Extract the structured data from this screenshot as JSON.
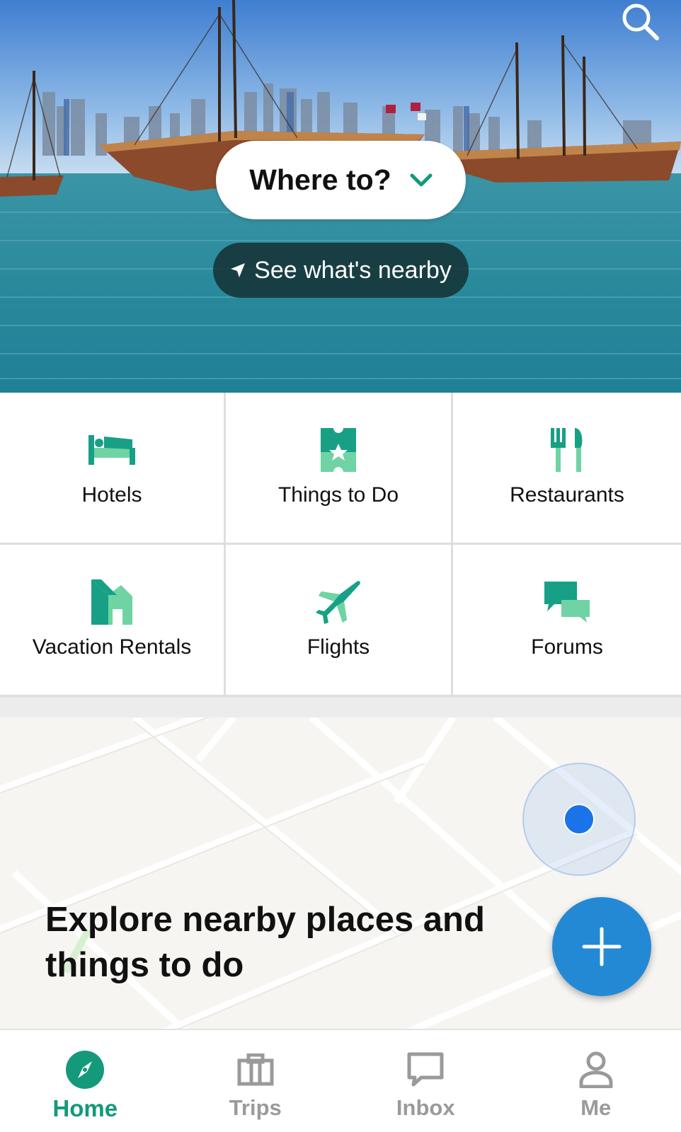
{
  "hero": {
    "where_to_label": "Where to?",
    "nearby_label": "See what's nearby"
  },
  "icons": {
    "search": "search-icon",
    "chevron": "chevron-down-icon",
    "location_arrow": "location-arrow-icon",
    "plus": "plus-icon"
  },
  "categories": [
    {
      "label": "Hotels",
      "icon": "bed-icon"
    },
    {
      "label": "Things to Do",
      "icon": "ticket-star-icon"
    },
    {
      "label": "Restaurants",
      "icon": "fork-knife-icon"
    },
    {
      "label": "Vacation Rentals",
      "icon": "house-icon"
    },
    {
      "label": "Flights",
      "icon": "airplane-icon"
    },
    {
      "label": "Forums",
      "icon": "chat-bubbles-icon"
    }
  ],
  "map": {
    "title": "Explore nearby places and things to do"
  },
  "bottom_nav": {
    "items": [
      {
        "label": "Home",
        "icon": "compass-icon",
        "active": true
      },
      {
        "label": "Trips",
        "icon": "briefcase-icon",
        "active": false
      },
      {
        "label": "Inbox",
        "icon": "message-icon",
        "active": false
      },
      {
        "label": "Me",
        "icon": "person-icon",
        "active": false
      }
    ]
  },
  "colors": {
    "accent_green": "#14997b",
    "icon_green_dark": "#17a085",
    "icon_green_light": "#6fd3a4",
    "fab_blue": "#2389d4",
    "location_blue": "#1a73e8"
  }
}
